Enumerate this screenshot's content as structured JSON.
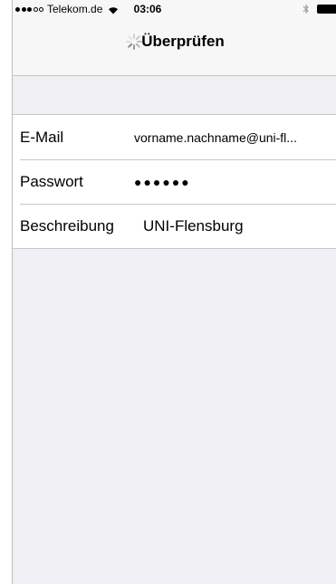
{
  "status_bar": {
    "carrier": "Telekom.de",
    "time": "03:06",
    "signal_icon": "signal-dots-icon",
    "wifi_icon": "wifi-icon",
    "bluetooth_icon": "bluetooth-icon",
    "battery_icon": "battery-icon"
  },
  "nav": {
    "title": "Überprüfen",
    "spinner_icon": "activity-spinner-icon"
  },
  "form": {
    "rows": [
      {
        "label": "E-Mail",
        "value": "vorname.nachname@uni-fl..."
      },
      {
        "label": "Passwort",
        "value": "●●●●●●"
      },
      {
        "label": "Beschreibung",
        "value": "UNI-Flensburg"
      }
    ]
  },
  "colors": {
    "background": "#efeff4",
    "bar": "#f7f7f7",
    "separator": "#c8c7cc"
  }
}
